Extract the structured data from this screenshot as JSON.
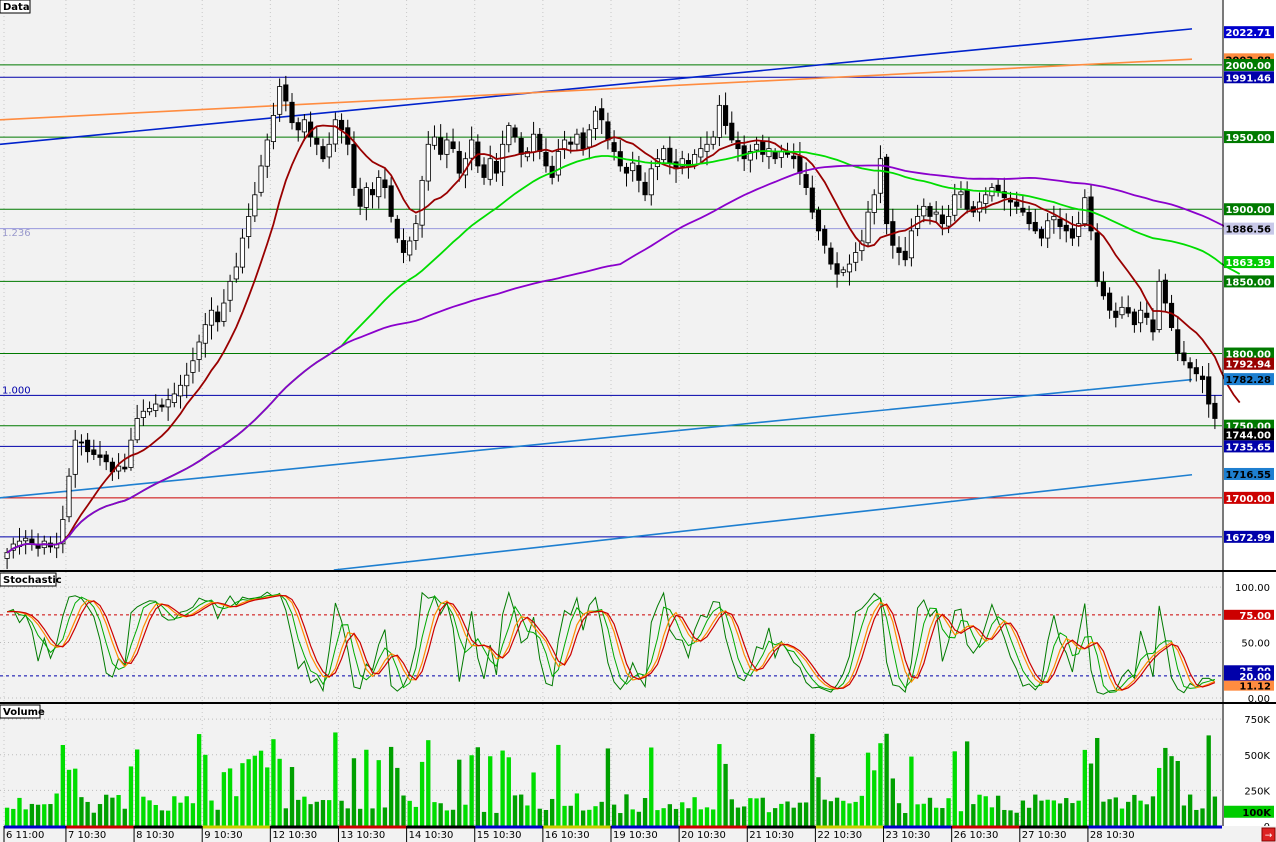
{
  "chart_data": {
    "type": "candlestick",
    "panels": {
      "price": {
        "label": "Data",
        "ylim": [
          1650,
          2045
        ],
        "right_axis_tags": [
          {
            "value": 2022.71,
            "label": "2022.71",
            "bg": "#0000cc",
            "fg": "#ffffff"
          },
          {
            "value": 2003.88,
            "label": "2003.88",
            "bg": "#ff8c40",
            "fg": "#000000"
          },
          {
            "value": 2000.0,
            "label": "2000.00",
            "bg": "#007a00",
            "fg": "#ffffff"
          },
          {
            "value": 1991.46,
            "label": "1991.46",
            "bg": "#0000aa",
            "fg": "#ffffff"
          },
          {
            "value": 1950.0,
            "label": "1950.00",
            "bg": "#007a00",
            "fg": "#ffffff"
          },
          {
            "value": 1900.0,
            "label": "1900.00",
            "bg": "#007a00",
            "fg": "#ffffff"
          },
          {
            "value": 1886.56,
            "label": "1886.56",
            "bg": "#c8c8e8",
            "fg": "#000000"
          },
          {
            "value": 1863.39,
            "label": "1863.39",
            "bg": "#00cc00",
            "fg": "#ffffff"
          },
          {
            "value": 1850.0,
            "label": "1850.00",
            "bg": "#007a00",
            "fg": "#ffffff"
          },
          {
            "value": 1800.0,
            "label": "1800.00",
            "bg": "#007a00",
            "fg": "#ffffff"
          },
          {
            "value": 1792.94,
            "label": "1792.94",
            "bg": "#990000",
            "fg": "#ffffff"
          },
          {
            "value": 1782.28,
            "label": "1782.28",
            "bg": "#1e7fd0",
            "fg": "#000000"
          },
          {
            "value": 1750.0,
            "label": "1750.00",
            "bg": "#007a00",
            "fg": "#ffffff"
          },
          {
            "value": 1744.0,
            "label": "1744.00",
            "bg": "#000000",
            "fg": "#ffffff"
          },
          {
            "value": 1735.65,
            "label": "1735.65",
            "bg": "#0000aa",
            "fg": "#ffffff"
          },
          {
            "value": 1716.55,
            "label": "1716.55",
            "bg": "#1e7fd0",
            "fg": "#000000"
          },
          {
            "value": 1700.0,
            "label": "1700.00",
            "bg": "#cc0000",
            "fg": "#ffffff"
          },
          {
            "value": 1672.99,
            "label": "1672.99",
            "bg": "#0000aa",
            "fg": "#ffffff"
          }
        ],
        "horizontal_lines": [
          {
            "value": 2000,
            "color": "#007a00"
          },
          {
            "value": 1991.46,
            "color": "#0000aa"
          },
          {
            "value": 1950,
            "color": "#007a00"
          },
          {
            "value": 1900,
            "color": "#007a00"
          },
          {
            "value": 1886.56,
            "color": "#9999dd"
          },
          {
            "value": 1850,
            "color": "#007a00"
          },
          {
            "value": 1800,
            "color": "#007a00"
          },
          {
            "value": 1771,
            "color": "#0000aa"
          },
          {
            "value": 1750,
            "color": "#007a00"
          },
          {
            "value": 1735.65,
            "color": "#0000aa"
          },
          {
            "value": 1700,
            "color": "#cc0000"
          },
          {
            "value": 1672.99,
            "color": "#0000aa"
          }
        ],
        "fib_labels": [
          {
            "value": 1880,
            "text": "1.236",
            "color": "#9999cc"
          },
          {
            "value": 1771,
            "text": "1.000",
            "color": "#0000aa"
          }
        ],
        "trendlines": [
          {
            "color": "#0022cc",
            "x0": 0,
            "y0": 1945,
            "x1": 1,
            "y1": 2025
          },
          {
            "color": "#ff8c40",
            "x0": 0,
            "y0": 1962,
            "x1": 1,
            "y1": 2004
          },
          {
            "color": "#1e7fd0",
            "x0": 0,
            "y0": 1700,
            "x1": 1,
            "y1": 1782
          },
          {
            "color": "#1e7fd0",
            "x0": 0.28,
            "y0": 1650,
            "x1": 1,
            "y1": 1716
          }
        ],
        "candle_count": 196,
        "close": [
          1662,
          1668,
          1670,
          1672,
          1668,
          1665,
          1670,
          1666,
          1668,
          1685,
          1715,
          1740,
          1738,
          1732,
          1730,
          1728,
          1725,
          1718,
          1722,
          1720,
          1740,
          1755,
          1760,
          1762,
          1765,
          1763,
          1768,
          1772,
          1778,
          1785,
          1795,
          1808,
          1820,
          1830,
          1822,
          1835,
          1850,
          1860,
          1880,
          1895,
          1910,
          1930,
          1948,
          1965,
          1985,
          1975,
          1960,
          1955,
          1962,
          1950,
          1945,
          1935,
          1945,
          1962,
          1955,
          1945,
          1915,
          1902,
          1915,
          1910,
          1922,
          1915,
          1895,
          1880,
          1870,
          1878,
          1890,
          1920,
          1945,
          1950,
          1938,
          1948,
          1942,
          1925,
          1935,
          1948,
          1930,
          1922,
          1935,
          1925,
          1945,
          1958,
          1950,
          1938,
          1940,
          1952,
          1940,
          1930,
          1922,
          1940,
          1948,
          1945,
          1952,
          1942,
          1955,
          1968,
          1962,
          1948,
          1940,
          1930,
          1925,
          1932,
          1920,
          1910,
          1928,
          1935,
          1942,
          1932,
          1928,
          1935,
          1930,
          1938,
          1942,
          1945,
          1950,
          1972,
          1958,
          1948,
          1942,
          1935,
          1940,
          1945,
          1938,
          1942,
          1935,
          1940,
          1938,
          1935,
          1925,
          1915,
          1898,
          1885,
          1875,
          1862,
          1855,
          1858,
          1862,
          1870,
          1878,
          1898,
          1910,
          1935,
          1890,
          1875,
          1870,
          1865,
          1885,
          1895,
          1902,
          1895,
          1898,
          1890,
          1895,
          1910,
          1912,
          1900,
          1898,
          1905,
          1910,
          1915,
          1912,
          1908,
          1905,
          1902,
          1898,
          1890,
          1885,
          1880,
          1892,
          1895,
          1888,
          1885,
          1880,
          1890,
          1908,
          1885,
          1850,
          1840,
          1830,
          1825,
          1832,
          1828,
          1820,
          1830,
          1825,
          1815,
          1850,
          1835,
          1818,
          1800,
          1795,
          1790,
          1786,
          1782,
          1765,
          1755,
          1750,
          1745,
          1748,
          1744
        ],
        "moving_averages": [
          {
            "name": "",
            "color": "#990000",
            "period": 10
          },
          {
            "name": "",
            "color": "#00dd00",
            "period": 55
          },
          {
            "name": "",
            "color": "#8a00cc",
            "period": 100
          }
        ]
      },
      "stochastic": {
        "label": "Stochastic",
        "ylim": [
          0,
          110
        ],
        "ticks": [
          {
            "value": 100,
            "label": "100.00"
          },
          {
            "value": 50,
            "label": "50.00"
          },
          {
            "value": 0,
            "label": "0.00"
          }
        ],
        "levels": [
          {
            "value": 75,
            "color": "#cc0000"
          },
          {
            "value": 20,
            "color": "#0000aa"
          }
        ],
        "tags": [
          {
            "value": 75,
            "label": "75.00",
            "bg": "#cc0000",
            "fg": "#ffffff"
          },
          {
            "value": 25,
            "label": "25.00",
            "bg": "#0000aa",
            "fg": "#ffffff"
          },
          {
            "value": 20,
            "label": "20.00",
            "bg": "#0000aa",
            "fg": "#ffffff"
          },
          {
            "value": 11.12,
            "label": "11.12",
            "bg": "#ff8c40",
            "fg": "#000000"
          }
        ]
      },
      "volume": {
        "label": "Volume",
        "ylim": [
          0,
          800000
        ],
        "ticks": [
          {
            "value": 750000,
            "label": "750K"
          },
          {
            "value": 500000,
            "label": "500K"
          },
          {
            "value": 250000,
            "label": "250K"
          },
          {
            "value": 0,
            "label": "0"
          }
        ],
        "tags": [
          {
            "value": 100000,
            "label": "100K",
            "bg": "#00cc00",
            "fg": "#000000"
          }
        ]
      }
    },
    "x_axis": {
      "labels": [
        "6 11:00",
        "7 10:30",
        "8 10:30",
        "9 10:30",
        "12 10:30",
        "13 10:30",
        "14 10:30",
        "15 10:30",
        "16 10:30",
        "19 10:30",
        "20 10:30",
        "21 10:30",
        "22 10:30",
        "23 10:30",
        "26 10:30",
        "27 10:30",
        "28 10:30"
      ],
      "label_candle_index": [
        0,
        10,
        21,
        32,
        43,
        54,
        65,
        76,
        87,
        98,
        109,
        120,
        131,
        142,
        153,
        164,
        175
      ]
    }
  }
}
